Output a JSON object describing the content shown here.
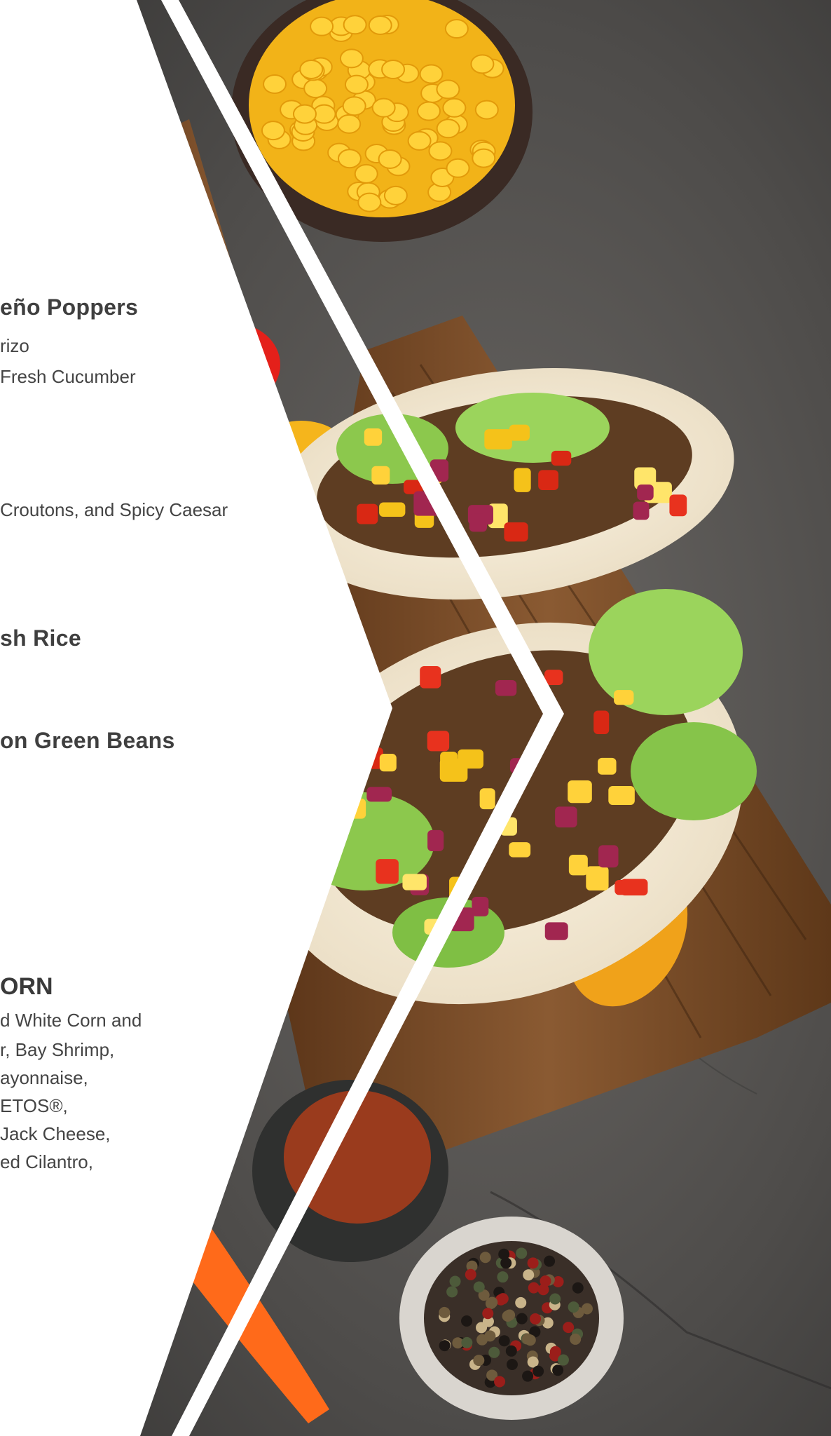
{
  "menu": {
    "item1": {
      "title": "eño Poppers",
      "line1": "rizo",
      "line2": "Fresh Cucumber"
    },
    "item2": {
      "line1": "Croutons, and Spicy Caesar"
    },
    "item3": {
      "title": "sh Rice"
    },
    "item4": {
      "title": "on Green Beans"
    },
    "item5": {
      "title": "ORN",
      "lines": [
        "d White Corn and",
        "r, Bay Shrimp,",
        "ayonnaise,",
        "ETOS®,",
        "Jack Cheese,",
        "ed Cilantro,"
      ]
    }
  },
  "colors": {
    "panel": "#ffffff",
    "text": "#444444",
    "stone": "#5a5856",
    "board": "#7a4a2a"
  }
}
